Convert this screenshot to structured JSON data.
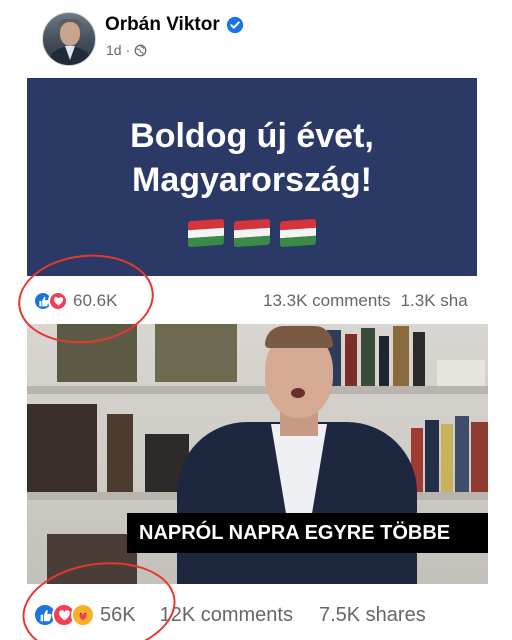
{
  "post": {
    "author": "Orbán Viktor",
    "time": "1d",
    "separator": "·"
  },
  "banner": {
    "line1": "Boldog új évet,",
    "line2": "Magyarország!"
  },
  "post1_stats": {
    "reaction_count": "60.6K",
    "comments": "13.3K comments",
    "shares": "1.3K sha"
  },
  "video": {
    "caption": "NAPRÓL NAPRA EGYRE TÖBBE"
  },
  "post2_stats": {
    "reaction_count": "56K",
    "comments": "12K comments",
    "shares": "7.5K shares"
  },
  "colors": {
    "facebook_blue": "#1b74e4",
    "love_red": "#f33e58",
    "annotation_red": "#e8372c",
    "banner_bg": "#2b3966"
  }
}
